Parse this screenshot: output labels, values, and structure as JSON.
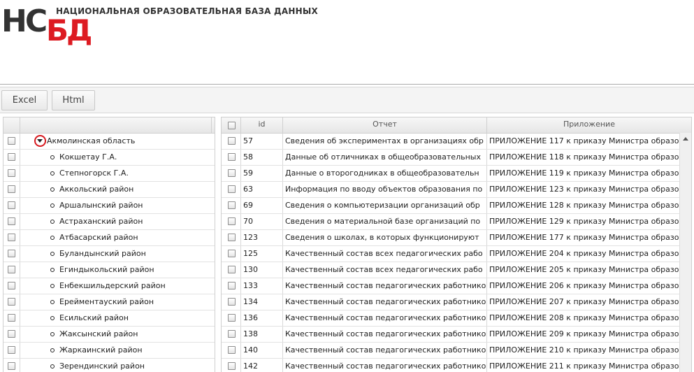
{
  "header": {
    "logo_hc": "НС",
    "logo_bd": "БД",
    "title": "НАЦИОНАЛЬНАЯ ОБРАЗОВАТЕЛЬНАЯ БАЗА ДАННЫХ"
  },
  "toolbar": {
    "excel_label": "Excel",
    "html_label": "Html"
  },
  "tree": {
    "root": "Акмолинская область",
    "children": [
      "Кокшетау Г.А.",
      "Степногорск Г.А.",
      "Аккольский район",
      "Аршалынский район",
      "Астраханский район",
      "Атбасарский район",
      "Буландынский район",
      "Егиндыкольский район",
      "Енбекшильдерский район",
      "Ерейментауский район",
      "Есильский район",
      "Жаксынский район",
      "Жаркаинский район",
      "Зерендинский район"
    ]
  },
  "reports": {
    "columns": {
      "id": "id",
      "report": "Отчет",
      "appendix": "Приложение"
    },
    "rows": [
      {
        "id": "57",
        "report": "Сведения об экспериментах в организациях обр",
        "appendix": "ПРИЛОЖЕНИЕ 117 к приказу Министра образо"
      },
      {
        "id": "58",
        "report": "Данные об отличниках в общеобразовательных",
        "appendix": "ПРИЛОЖЕНИЕ 118 к приказу Министра образо"
      },
      {
        "id": "59",
        "report": "Данные о второгодниках в общеобразовательн",
        "appendix": "ПРИЛОЖЕНИЕ 119 к приказу Министра образо"
      },
      {
        "id": "63",
        "report": "Информация по вводу объектов образования по",
        "appendix": "ПРИЛОЖЕНИЕ 123 к приказу Министра образо"
      },
      {
        "id": "69",
        "report": "Сведения  о компьютеризации организаций обр",
        "appendix": "ПРИЛОЖЕНИЕ 128 к приказу Министра образо"
      },
      {
        "id": "70",
        "report": "Сведения  о материальной базе организаций по",
        "appendix": "ПРИЛОЖЕНИЕ 129 к приказу Министра образо"
      },
      {
        "id": "123",
        "report": "Сведения о школах, в которых функционируют",
        "appendix": "ПРИЛОЖЕНИЕ 177 к приказу Министра образо"
      },
      {
        "id": "125",
        "report": "Качественный состав всех педагогических рабо",
        "appendix": "ПРИЛОЖЕНИЕ 204 к приказу Министра образо"
      },
      {
        "id": "130",
        "report": "Качественный состав всех педагогических рабо",
        "appendix": "ПРИЛОЖЕНИЕ 205 к приказу Министра образо"
      },
      {
        "id": "133",
        "report": "Качественный состав педагогических работнико",
        "appendix": "ПРИЛОЖЕНИЕ 206 к приказу Министра образо"
      },
      {
        "id": "134",
        "report": "Качественный состав педагогических работнико",
        "appendix": "ПРИЛОЖЕНИЕ 207 к приказу Министра образо"
      },
      {
        "id": "136",
        "report": "Качественный состав педагогических работнико",
        "appendix": "ПРИЛОЖЕНИЕ 208 к приказу Министра образо"
      },
      {
        "id": "138",
        "report": "Качественный состав педагогических работнико",
        "appendix": "ПРИЛОЖЕНИЕ 209 к приказу Министра образо"
      },
      {
        "id": "140",
        "report": "Качественный состав педагогических работнико",
        "appendix": "ПРИЛОЖЕНИЕ 210 к приказу Министра образо"
      },
      {
        "id": "142",
        "report": "Качественный состав педагогических работнико",
        "appendix": "ПРИЛОЖЕНИЕ 211 к приказу Министра образо"
      }
    ]
  },
  "colors": {
    "brand_red": "#dd1b22",
    "logo_grey": "#333333"
  },
  "icons": {
    "expander": "chevron-down-icon",
    "leaf": "bullet-icon",
    "scroll": "scroll-up-arrow-icon"
  }
}
